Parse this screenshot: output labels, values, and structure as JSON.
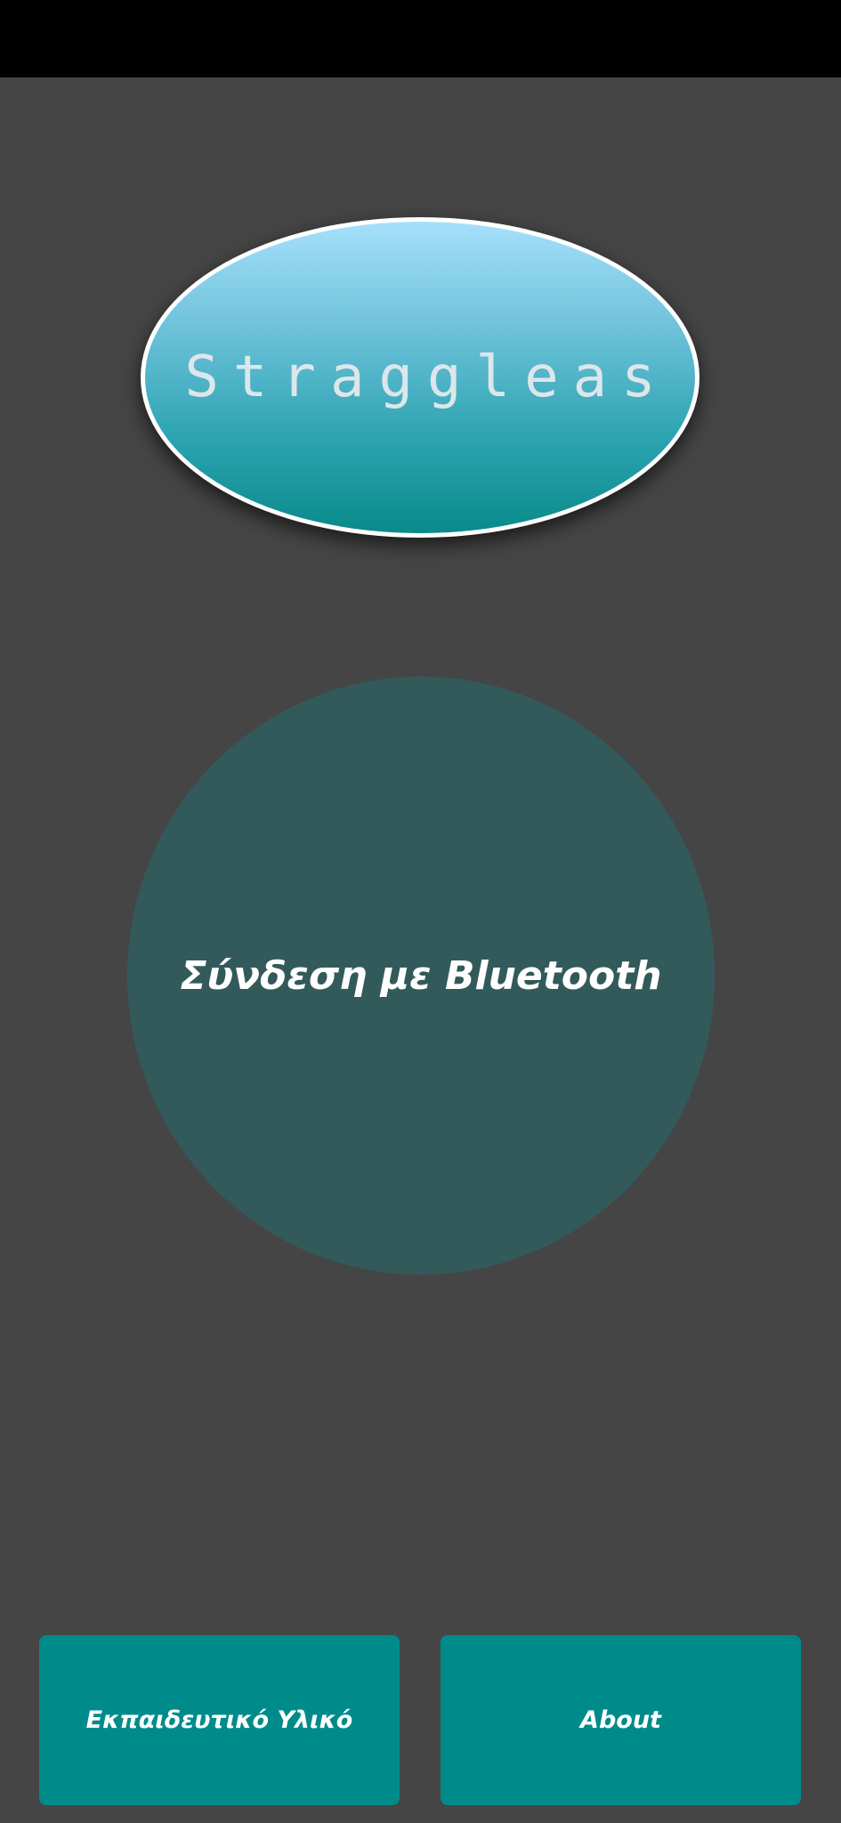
{
  "app": {
    "logo_text": "Straggleas"
  },
  "main": {
    "bluetooth_button_label": "Σύνδεση με Bluetooth"
  },
  "bottom": {
    "educational_button_label": "Εκπαιδευτικό Υλικό",
    "about_button_label": "About"
  },
  "colors": {
    "background": "#454545",
    "status_bar": "#000000",
    "circle": "#335a5b",
    "button": "#008b8b",
    "logo_gradient_top": "#a6e0fb",
    "logo_gradient_bottom": "#0a8a8a"
  }
}
